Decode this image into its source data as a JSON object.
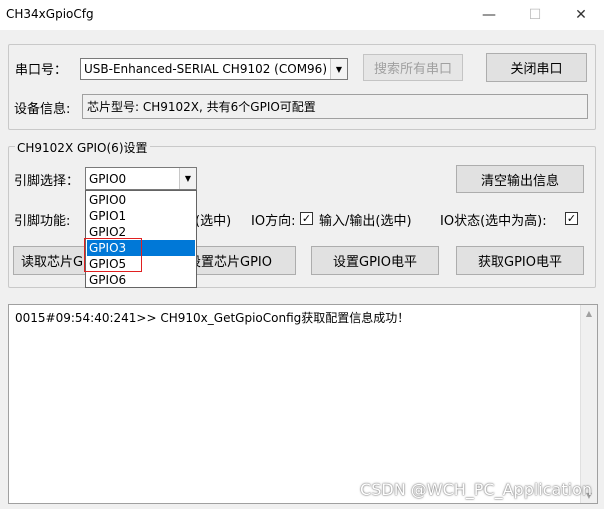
{
  "window": {
    "title": "CH34xGpioCfg",
    "min_glyph": "—",
    "max_glyph": "☐",
    "close_glyph": "✕"
  },
  "port": {
    "label": "串口号：",
    "selected": "USB-Enhanced-SERIAL CH9102 (COM96)",
    "search_button": "搜索所有串口",
    "close_button": "关闭串口"
  },
  "device": {
    "label": "设备信息:",
    "info": "芯片型号: CH9102X, 共有6个GPIO可配置"
  },
  "gpio_group": {
    "title": "CH9102X GPIO(6)设置",
    "pin_select_label": "引脚选择：",
    "pin_selected": "GPIO0",
    "clear_button": "清空输出信息",
    "pin_function_label": "引脚功能:",
    "pin_function_suffix": "(选中)",
    "io_direction_label": "IO方向:",
    "io_direction_value": "输入/输出(选中)",
    "io_state_label": "IO状态(选中为高):",
    "read_button": "读取芯片GPIO配置",
    "set_config_button": "设置芯片GPIO",
    "set_level_button": "设置GPIO电平",
    "get_level_button": "获取GPIO电平",
    "dropdown_options": [
      "GPIO0",
      "GPIO1",
      "GPIO2",
      "GPIO3",
      "GPIO5",
      "GPIO6"
    ],
    "highlighted_option": "GPIO3"
  },
  "log": {
    "lines": [
      "0015#09:54:40:241>> CH910x_GetGpioConfig获取配置信息成功！"
    ]
  },
  "watermark": "CSDN @WCH_PC_Application",
  "colors": {
    "selection": "#0078d7",
    "annotation": "#e02020",
    "window_bg": "#f0f0f0"
  }
}
